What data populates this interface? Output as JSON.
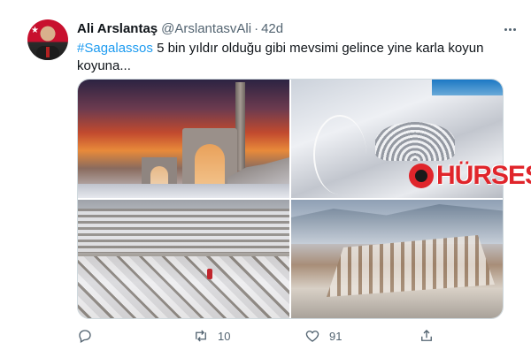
{
  "tweet": {
    "author": {
      "display_name": "Ali Arslantaş",
      "handle": "@ArslantasvAli",
      "avatar_icon": "profile-photo"
    },
    "separator": "·",
    "timestamp": "42d",
    "text": {
      "hashtag": "#Sagalassos",
      "body": " 5 bin yıldır olduğu gibi mevsimi gelince yine karla koyun koyuna..."
    },
    "media": {
      "count": 4,
      "watermark": "HÜRSES"
    },
    "actions": {
      "reply": {
        "icon": "reply-icon",
        "count": ""
      },
      "retweet": {
        "icon": "retweet-icon",
        "count": "10"
      },
      "like": {
        "icon": "heart-icon",
        "count": "91"
      },
      "share": {
        "icon": "share-icon"
      }
    }
  },
  "colors": {
    "link": "#1d9bf0",
    "text": "#0f1419",
    "secondary": "#536471",
    "watermark": "#e0252b"
  }
}
